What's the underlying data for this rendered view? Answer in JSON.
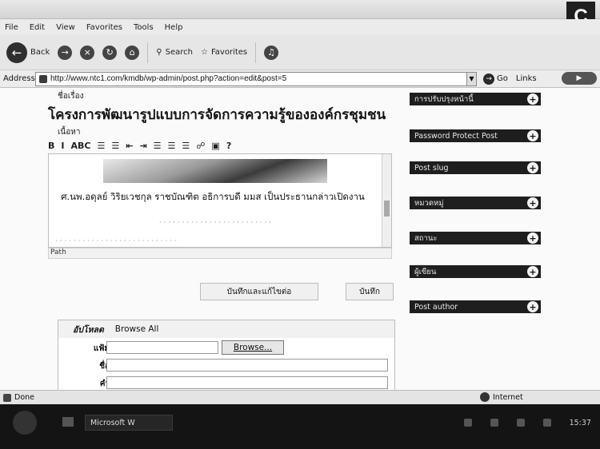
{
  "browser": {
    "menu": [
      "File",
      "Edit",
      "View",
      "Favorites",
      "Tools",
      "Help"
    ],
    "toolbar": {
      "back_label": "Back",
      "search_label": "Search",
      "favorites_label": "Favorites"
    },
    "address": {
      "label": "Address",
      "url": "http://www.ntc1.com/kmdb/wp-admin/post.php?action=edit&post=5",
      "go_label": "Go",
      "links_label": "Links"
    },
    "status": {
      "left": "Done",
      "zone": "Internet"
    }
  },
  "editor": {
    "title_label": "ชื่อเรื่อง",
    "title_value": "โครงการพัฒนารูปแบบการจัดการความรู้ขององค์กรชุมชน",
    "content_label": "เนื้อหา",
    "toolbar_buttons": [
      "B",
      "I",
      "ABC"
    ],
    "body_line": "ศ.นพ.อดุลย์ วิริยเวชกุล ราชบัณฑิต อธิการบดี มมส เป็นประธานกล่าวเปิดงาน",
    "path_label": "Path"
  },
  "actions": {
    "save_continue_label": "บันทึกและแก้ไขต่อ",
    "save_label": "บันทึก"
  },
  "upload": {
    "tab_upload": "อัปโหลด",
    "tab_browse_all": "Browse All",
    "file_label": "แฟ้ม",
    "title_label": "ชื่อ",
    "desc_label": "คำ",
    "browse_label": "Browse..."
  },
  "sidebar": [
    {
      "label": "การปรับปรุงหน้านี้"
    },
    {
      "label": "Password Protect Post"
    },
    {
      "label": "Post slug"
    },
    {
      "label": "หมวดหมู่"
    },
    {
      "label": "สถานะ"
    },
    {
      "label": "ผู้เขียน"
    },
    {
      "label": "Post author"
    }
  ],
  "taskbar": {
    "task_label": "Microsoft W",
    "clock": "15:37"
  }
}
